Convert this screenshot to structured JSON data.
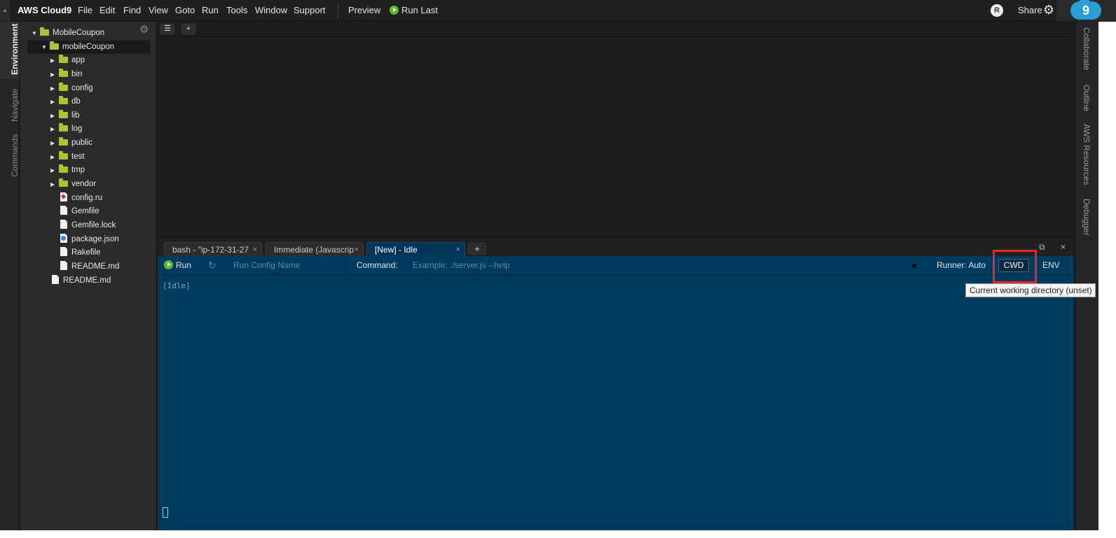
{
  "menubar": {
    "brand": "AWS Cloud9",
    "items": [
      "File",
      "Edit",
      "Find",
      "View",
      "Goto",
      "Run",
      "Tools",
      "Window",
      "Support"
    ],
    "preview": "Preview",
    "run_last": "Run Last",
    "avatar_letter": "R",
    "share": "Share",
    "logo_digit": "9"
  },
  "left_tabs": [
    "Environment",
    "Navigate",
    "Commands"
  ],
  "tree": {
    "root": "MobileCoupon",
    "project": "mobileCoupon",
    "folders": [
      "app",
      "bin",
      "config",
      "db",
      "lib",
      "log",
      "public",
      "test",
      "tmp",
      "vendor"
    ],
    "files": [
      {
        "name": "config.ru",
        "icon": "ruby-icon"
      },
      {
        "name": "Gemfile",
        "icon": "file-icon"
      },
      {
        "name": "Gemfile.lock",
        "icon": "file-icon"
      },
      {
        "name": "package.json",
        "icon": "json-icon"
      },
      {
        "name": "Rakefile",
        "icon": "file-icon"
      },
      {
        "name": "README.md",
        "icon": "file-icon"
      }
    ],
    "root_file": "README.md"
  },
  "console": {
    "tabs": [
      {
        "label": "bash - \"ip-172-31-27",
        "close": "×"
      },
      {
        "label": "Immediate (Javascrip",
        "close": "×"
      },
      {
        "label": "[New] - Idle",
        "close": "×"
      }
    ],
    "add_tab": "+",
    "maximize_glyph": "⧉",
    "close_glyph": "×",
    "runner": {
      "run_label": "Run",
      "config_placeholder": "Run Config Name",
      "command_label": "Command:",
      "command_placeholder": "Example: ./server.js --help",
      "runner_label": "Runner: Auto",
      "cwd": "CWD",
      "env": "ENV"
    },
    "tooltip": "Current working directory (unset)",
    "status": "[Idle]"
  },
  "right_tabs": [
    "Collaborate",
    "Outline",
    "AWS Resources",
    "Debugger"
  ],
  "colors": {
    "console_bg": "#003a5e",
    "folder": "#a7c635",
    "run_green": "#5cb830",
    "highlight": "#e8262a"
  }
}
